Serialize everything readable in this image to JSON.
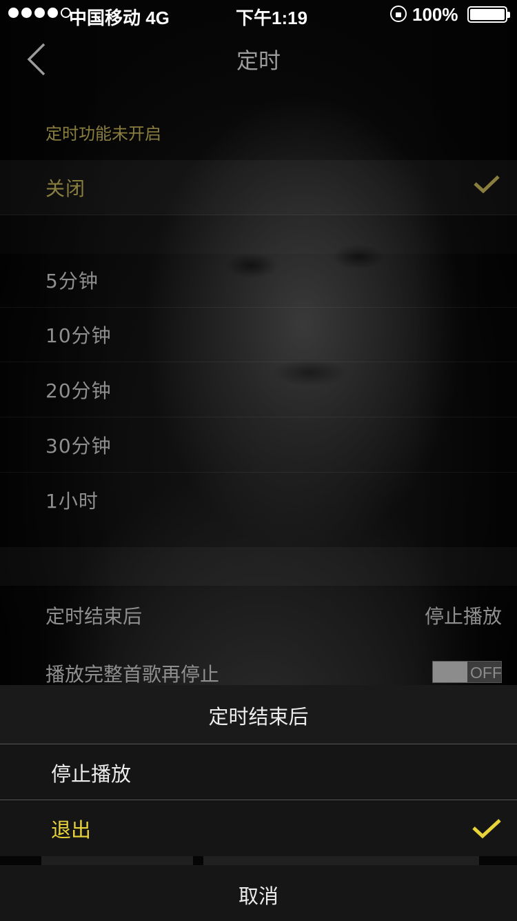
{
  "status_bar": {
    "carrier": "中国移动 4G",
    "time": "下午1:19",
    "battery": "100%"
  },
  "nav": {
    "title": "定时"
  },
  "timer": {
    "status_text": "定时功能未开启",
    "options": [
      {
        "label": "关闭",
        "selected": true
      },
      {
        "label": "5分钟",
        "selected": false
      },
      {
        "label": "10分钟",
        "selected": false
      },
      {
        "label": "20分钟",
        "selected": false
      },
      {
        "label": "30分钟",
        "selected": false
      },
      {
        "label": "1小时",
        "selected": false
      }
    ]
  },
  "settings": {
    "after_end_label": "定时结束后",
    "after_end_value": "停止播放",
    "finish_song_label": "播放完整首歌再停止",
    "finish_song_toggle": "OFF"
  },
  "action_sheet": {
    "title": "定时结束后",
    "options": [
      {
        "label": "停止播放",
        "selected": false
      },
      {
        "label": "退出",
        "selected": true
      }
    ],
    "cancel": "取消"
  },
  "colors": {
    "accent_dim": "#8a7e3f",
    "accent_bright": "#e8d33a"
  }
}
